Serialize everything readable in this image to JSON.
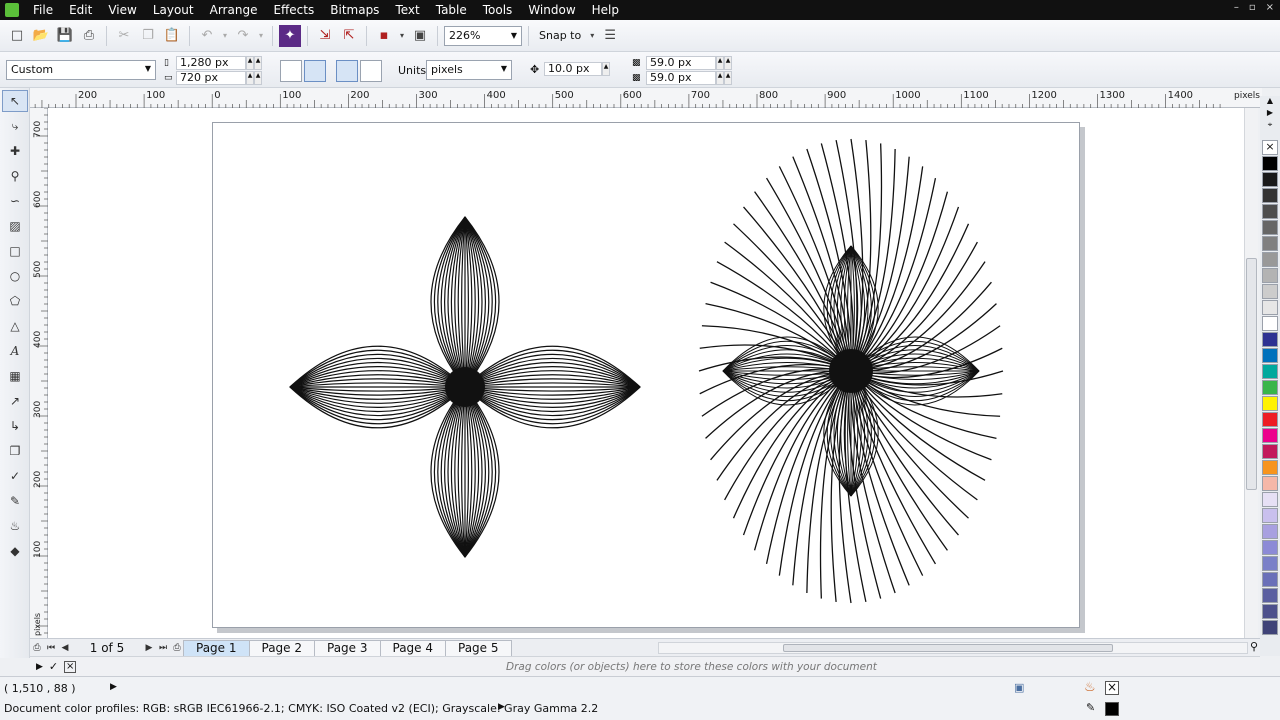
{
  "menu": [
    "File",
    "Edit",
    "View",
    "Layout",
    "Arrange",
    "Effects",
    "Bitmaps",
    "Text",
    "Table",
    "Tools",
    "Window",
    "Help"
  ],
  "window_controls": [
    "–",
    "▫",
    "×"
  ],
  "toolbar": {
    "zoom": "226%",
    "snap_label": "Snap to"
  },
  "property_bar": {
    "preset": "Custom",
    "width": "1,280 px",
    "height": "720 px",
    "units_label": "Units:",
    "units": "pixels",
    "nudge": "10.0 px",
    "dup_x": "59.0 px",
    "dup_y": "59.0 px"
  },
  "rulers": {
    "h_ticks": [
      "200",
      "100",
      "0",
      "100",
      "200",
      "300",
      "400",
      "500",
      "600",
      "700",
      "800",
      "900",
      "1000",
      "1100",
      "1200",
      "1300",
      "1400"
    ],
    "h_unit": "pixels",
    "v_ticks": [
      "700",
      "600",
      "500",
      "400",
      "300",
      "200",
      "100"
    ],
    "v_unit": "pixels"
  },
  "pages": {
    "counter": "1 of 5",
    "tabs": [
      "Page 1",
      "Page 2",
      "Page 3",
      "Page 4",
      "Page 5"
    ],
    "active": 0
  },
  "color_docker_hint": "Drag colors (or objects) here to store these colors with your document",
  "status": {
    "coords": "( 1,510 , 88   )",
    "profiles": "Document color profiles: RGB: sRGB IEC61966-2.1; CMYK: ISO Coated v2 (ECI); Grayscale: Gray Gamma 2.2"
  },
  "palette_colors": [
    "#000000",
    "#1a1a1a",
    "#333333",
    "#4d4d4d",
    "#666666",
    "#808080",
    "#999999",
    "#b3b3b3",
    "#cccccc",
    "#e6e6e6",
    "#ffffff",
    "#2e3192",
    "#0071bc",
    "#00a99d",
    "#39b54a",
    "#fff200",
    "#ed1c24",
    "#ec008c",
    "#c2185b",
    "#f7941d",
    "#f5b7a8",
    "#e6e0f5",
    "#c9c0ee",
    "#a8a0e0",
    "#8c8ad6",
    "#7a80c8",
    "#6a70b8",
    "#5a5fa0",
    "#4c508c",
    "#3f4378"
  ],
  "icons": {
    "tools": [
      "pick-icon",
      "shape-icon",
      "crop-icon",
      "zoom-icon",
      "freehand-icon",
      "smart-fill-icon",
      "rectangle-icon",
      "ellipse-icon",
      "polygon-icon",
      "basic-shapes-icon",
      "text-icon",
      "table-icon",
      "dimension-icon",
      "connector-icon",
      "blend-icon",
      "eyedropper-icon",
      "outline-icon",
      "fill-icon",
      "interactive-fill-icon"
    ]
  }
}
